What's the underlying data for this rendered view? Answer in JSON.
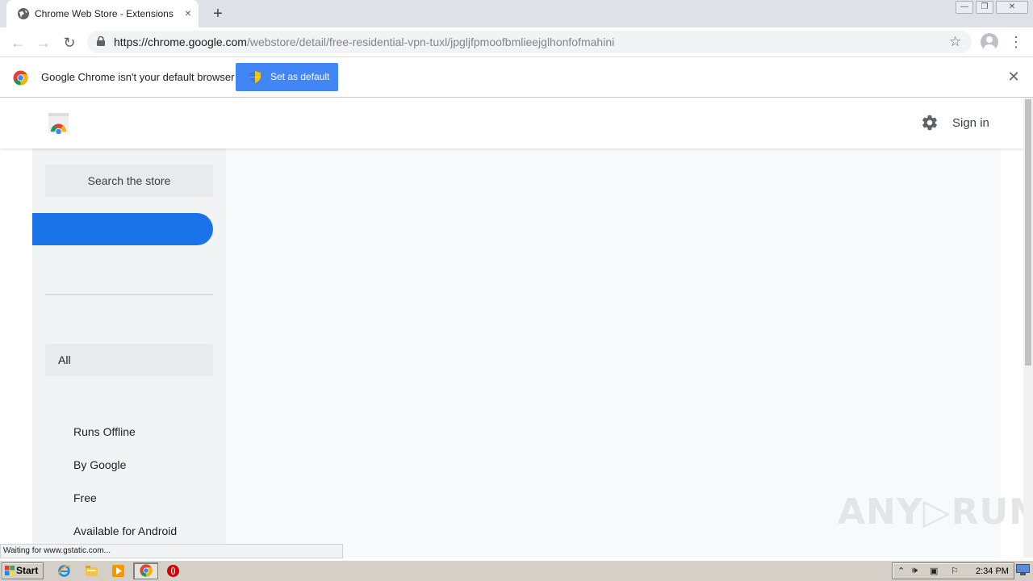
{
  "window": {
    "tab_title": "Chrome Web Store - Extensions",
    "tab_close": "×",
    "new_tab": "+",
    "min": "—",
    "restore": "❐",
    "close": "✕"
  },
  "toolbar": {
    "back": "←",
    "forward": "→",
    "reload": "↻",
    "url_host": "https://chrome.google.com",
    "url_path": "/webstore/detail/free-residential-vpn-tuxl/jpgljfpmoofbmlieejglhonfofmahini",
    "star": "☆",
    "menu": "⋮"
  },
  "infobar": {
    "message": "Google Chrome isn't your default browser",
    "button": "Set as default",
    "close": "✕"
  },
  "store": {
    "signin": "Sign in",
    "search_placeholder": "Search the store",
    "category_selected": "All",
    "filters": [
      "Runs Offline",
      "By Google",
      "Free",
      "Available for Android"
    ]
  },
  "status_bar": "Waiting for www.gstatic.com...",
  "watermark": "ANY▷RUN",
  "taskbar": {
    "start": "Start",
    "clock": "2:34 PM"
  },
  "colors": {
    "accent_blue": "#1a73e8",
    "infobar_button": "#4285f4",
    "sidebar_bg": "#f1f3f4"
  }
}
